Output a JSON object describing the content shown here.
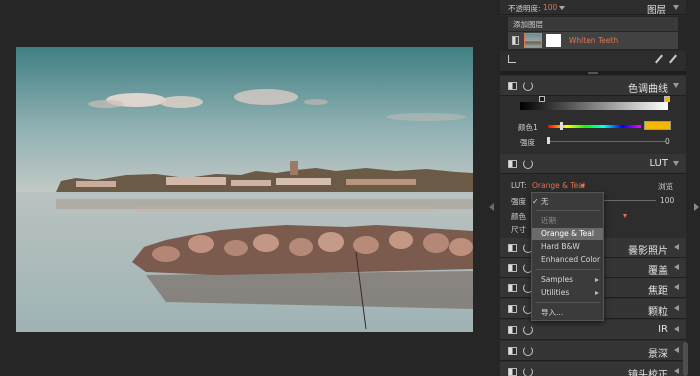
{
  "layers_panel": {
    "opacity_label": "不透明度:",
    "opacity_value": "100",
    "title": "图层",
    "add_layer": "添加图层",
    "layer_name": "Whiten Teeth"
  },
  "curves_panel": {
    "title": "色调曲线",
    "color_label": "颜色1",
    "strength_label": "强度",
    "strength_value": "0",
    "swatch_color": "#f5b800"
  },
  "lut_panel": {
    "title": "LUT",
    "lut_label": "LUT:",
    "lut_value": "Orange & Teal",
    "browse_label": "浏览",
    "strength_label": "强度",
    "strength_value": "100",
    "color_label": "颜色",
    "size_label": "尺寸"
  },
  "lut_menu": {
    "none": "无",
    "recent_header": "近期",
    "items": [
      "Orange & Teal",
      "Hard B&W",
      "Enhanced Color"
    ],
    "samples": "Samples",
    "utilities": "Utilities",
    "import": "导入..."
  },
  "section_titles": {
    "film": "曇影照片",
    "overlay": "覆盖",
    "focus": "焦距",
    "grain": "颗粒",
    "ir": "IR",
    "dof": "景深",
    "lens": "镜头校正"
  },
  "accent_color": "#e4744b"
}
